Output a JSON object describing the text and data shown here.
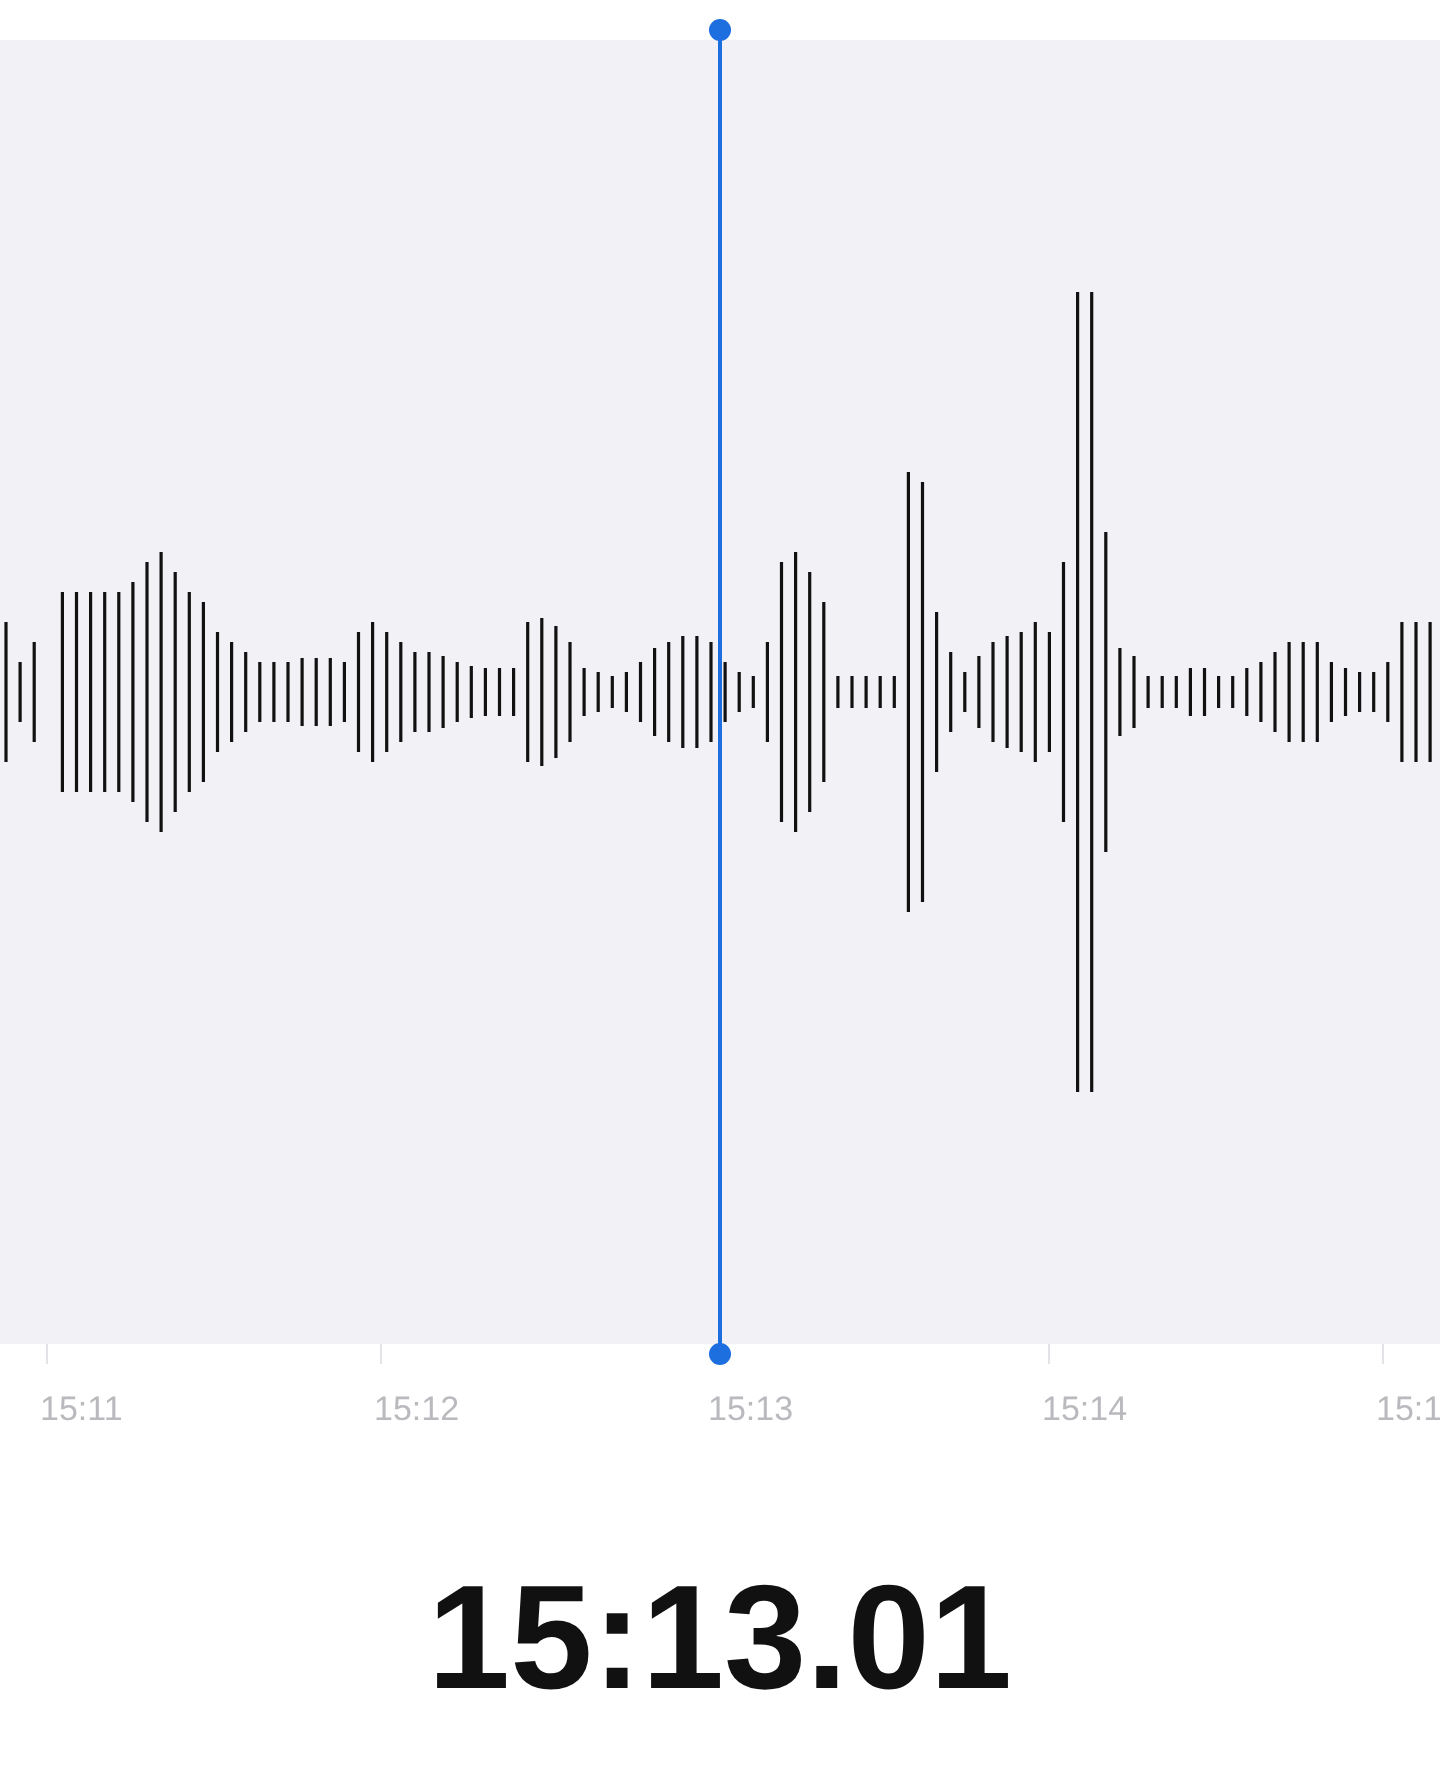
{
  "timeline": {
    "labels": [
      "15:11",
      "15:12",
      "15:13",
      "15:14",
      "15:1"
    ]
  },
  "current_time": "15:13.01"
}
